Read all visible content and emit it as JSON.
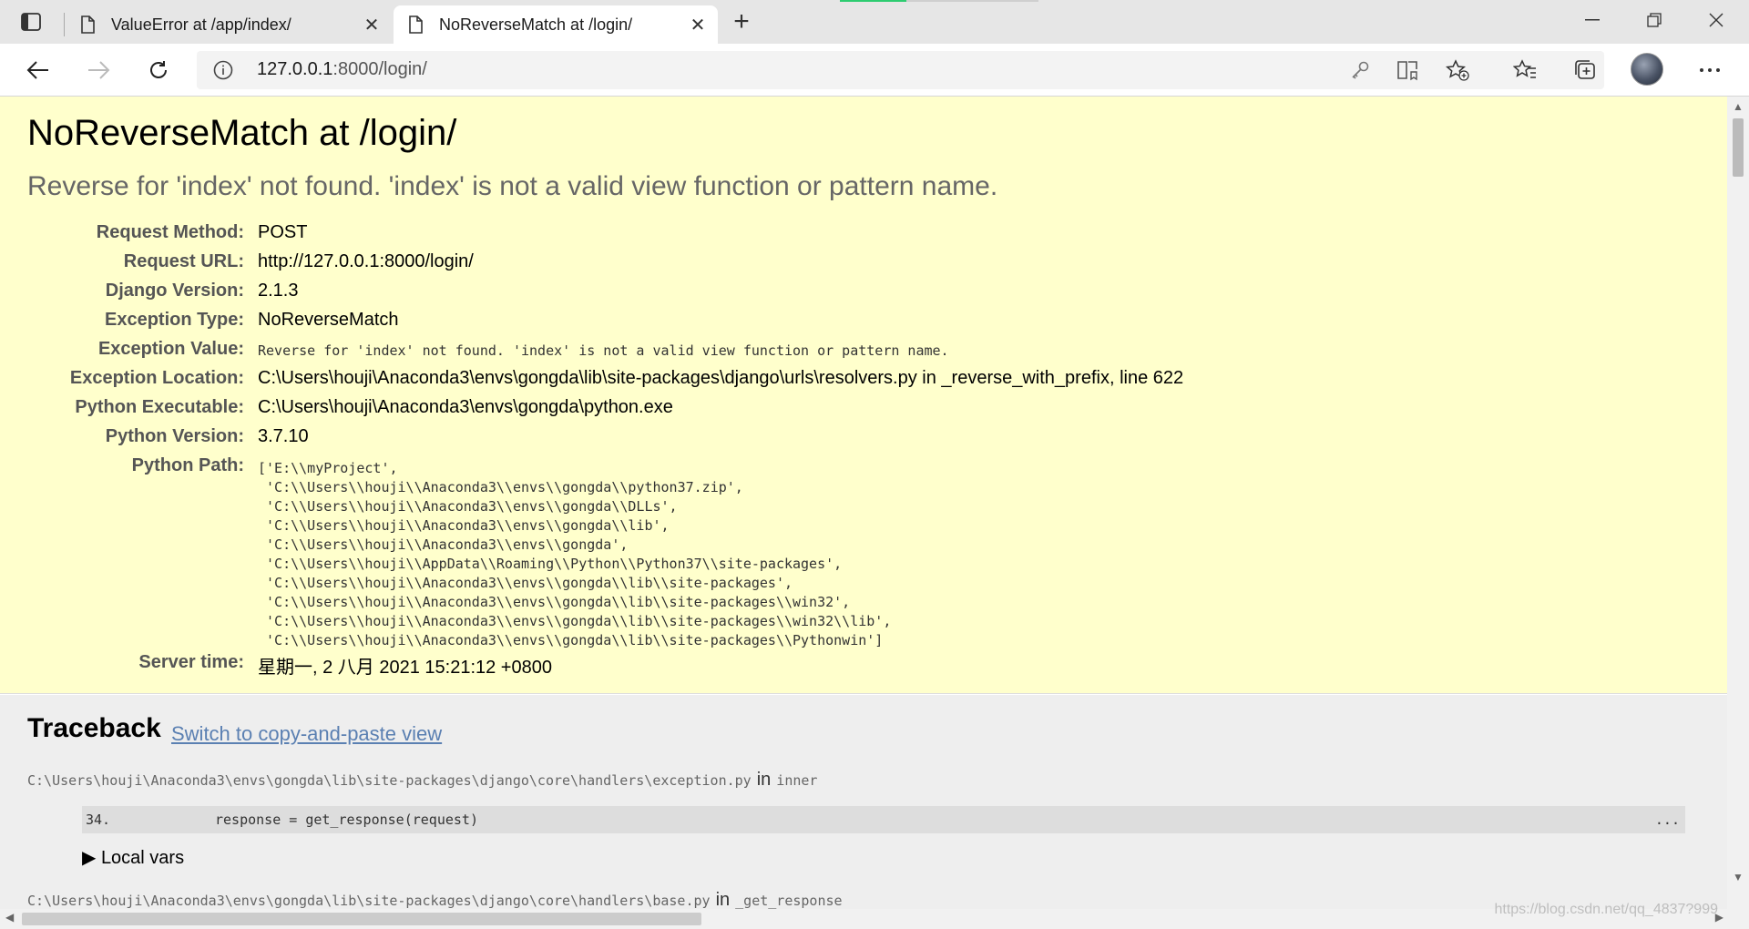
{
  "browser": {
    "tabs": [
      {
        "title": "ValueError at /app/index/",
        "active": false
      },
      {
        "title": "NoReverseMatch at /login/",
        "active": true
      }
    ],
    "new_tab_label": "+",
    "address": {
      "host": "127.0.0.1",
      "path": ":8000/login/"
    },
    "icons": {
      "tab_actions": "tab-actions-icon",
      "back": "back-arrow-icon",
      "forward": "forward-arrow-icon",
      "refresh": "refresh-icon",
      "info": "info-icon",
      "key": "key-icon",
      "immersive_reader": "immersive-reader-icon",
      "add_favorite": "add-favorite-icon",
      "favorites": "favorites-icon",
      "collections": "collections-icon",
      "menu": "more-menu-icon"
    }
  },
  "error": {
    "title": "NoReverseMatch at /login/",
    "subtitle": "Reverse for 'index' not found. 'index' is not a valid view function or pattern name.",
    "meta": [
      {
        "key": "Request Method:",
        "value": "POST"
      },
      {
        "key": "Request URL:",
        "value": "http://127.0.0.1:8000/login/"
      },
      {
        "key": "Django Version:",
        "value": "2.1.3"
      },
      {
        "key": "Exception Type:",
        "value": "NoReverseMatch"
      },
      {
        "key": "Exception Value:",
        "value": "Reverse for 'index' not found. 'index' is not a valid view function or pattern name."
      },
      {
        "key": "Exception Location:",
        "value": "C:\\Users\\houji\\Anaconda3\\envs\\gongda\\lib\\site-packages\\django\\urls\\resolvers.py in _reverse_with_prefix, line 622"
      },
      {
        "key": "Python Executable:",
        "value": "C:\\Users\\houji\\Anaconda3\\envs\\gongda\\python.exe"
      },
      {
        "key": "Python Version:",
        "value": "3.7.10"
      },
      {
        "key": "Python Path:",
        "value": ""
      },
      {
        "key": "Server time:",
        "value": "星期一, 2 八月 2021 15:21:12 +0800"
      }
    ],
    "python_path": [
      "['E:\\\\myProject',",
      " 'C:\\\\Users\\\\houji\\\\Anaconda3\\\\envs\\\\gongda\\\\python37.zip',",
      " 'C:\\\\Users\\\\houji\\\\Anaconda3\\\\envs\\\\gongda\\\\DLLs',",
      " 'C:\\\\Users\\\\houji\\\\Anaconda3\\\\envs\\\\gongda\\\\lib',",
      " 'C:\\\\Users\\\\houji\\\\Anaconda3\\\\envs\\\\gongda',",
      " 'C:\\\\Users\\\\houji\\\\AppData\\\\Roaming\\\\Python\\\\Python37\\\\site-packages',",
      " 'C:\\\\Users\\\\houji\\\\Anaconda3\\\\envs\\\\gongda\\\\lib\\\\site-packages',",
      " 'C:\\\\Users\\\\houji\\\\Anaconda3\\\\envs\\\\gongda\\\\lib\\\\site-packages\\\\win32',",
      " 'C:\\\\Users\\\\houji\\\\Anaconda3\\\\envs\\\\gongda\\\\lib\\\\site-packages\\\\win32\\\\lib',",
      " 'C:\\\\Users\\\\houji\\\\Anaconda3\\\\envs\\\\gongda\\\\lib\\\\site-packages\\\\Pythonwin']"
    ]
  },
  "traceback": {
    "heading": "Traceback",
    "switch_link": "Switch to copy-and-paste view",
    "in_word": "in",
    "frames": [
      {
        "file": "C:\\Users\\houji\\Anaconda3\\envs\\gongda\\lib\\site-packages\\django\\core\\handlers\\exception.py",
        "func": "inner",
        "line_no": "34.",
        "code": "response = get_response(request)",
        "dots": "...",
        "local_vars": "▶ Local vars"
      },
      {
        "file": "C:\\Users\\houji\\Anaconda3\\envs\\gongda\\lib\\site-packages\\django\\core\\handlers\\base.py",
        "func": "_get_response"
      }
    ]
  },
  "watermark": "https://blog.csdn.net/qq_4837?999"
}
